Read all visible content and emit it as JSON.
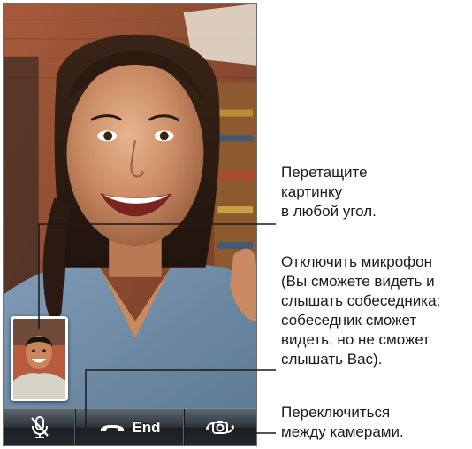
{
  "controls": {
    "mute_icon": "mic-mute-icon",
    "end_icon": "phone-handset-icon",
    "end_label": "End",
    "switch_icon": "camera-switch-icon"
  },
  "callouts": {
    "drag_picture": "Перетащите\nкартинку\nв любой угол.",
    "mute": "Отключить микрофон\n(Вы сможете видеть и\nслышать собеседника;\nсобеседник сможет\nвидеть, но не сможет\nслышать Вас).",
    "switch_camera": "Переключиться\nмежду камерами."
  },
  "colors": {
    "callout_line": "#1a1a1a",
    "control_bar": "#2d343b",
    "end_label": "#ffffff"
  }
}
